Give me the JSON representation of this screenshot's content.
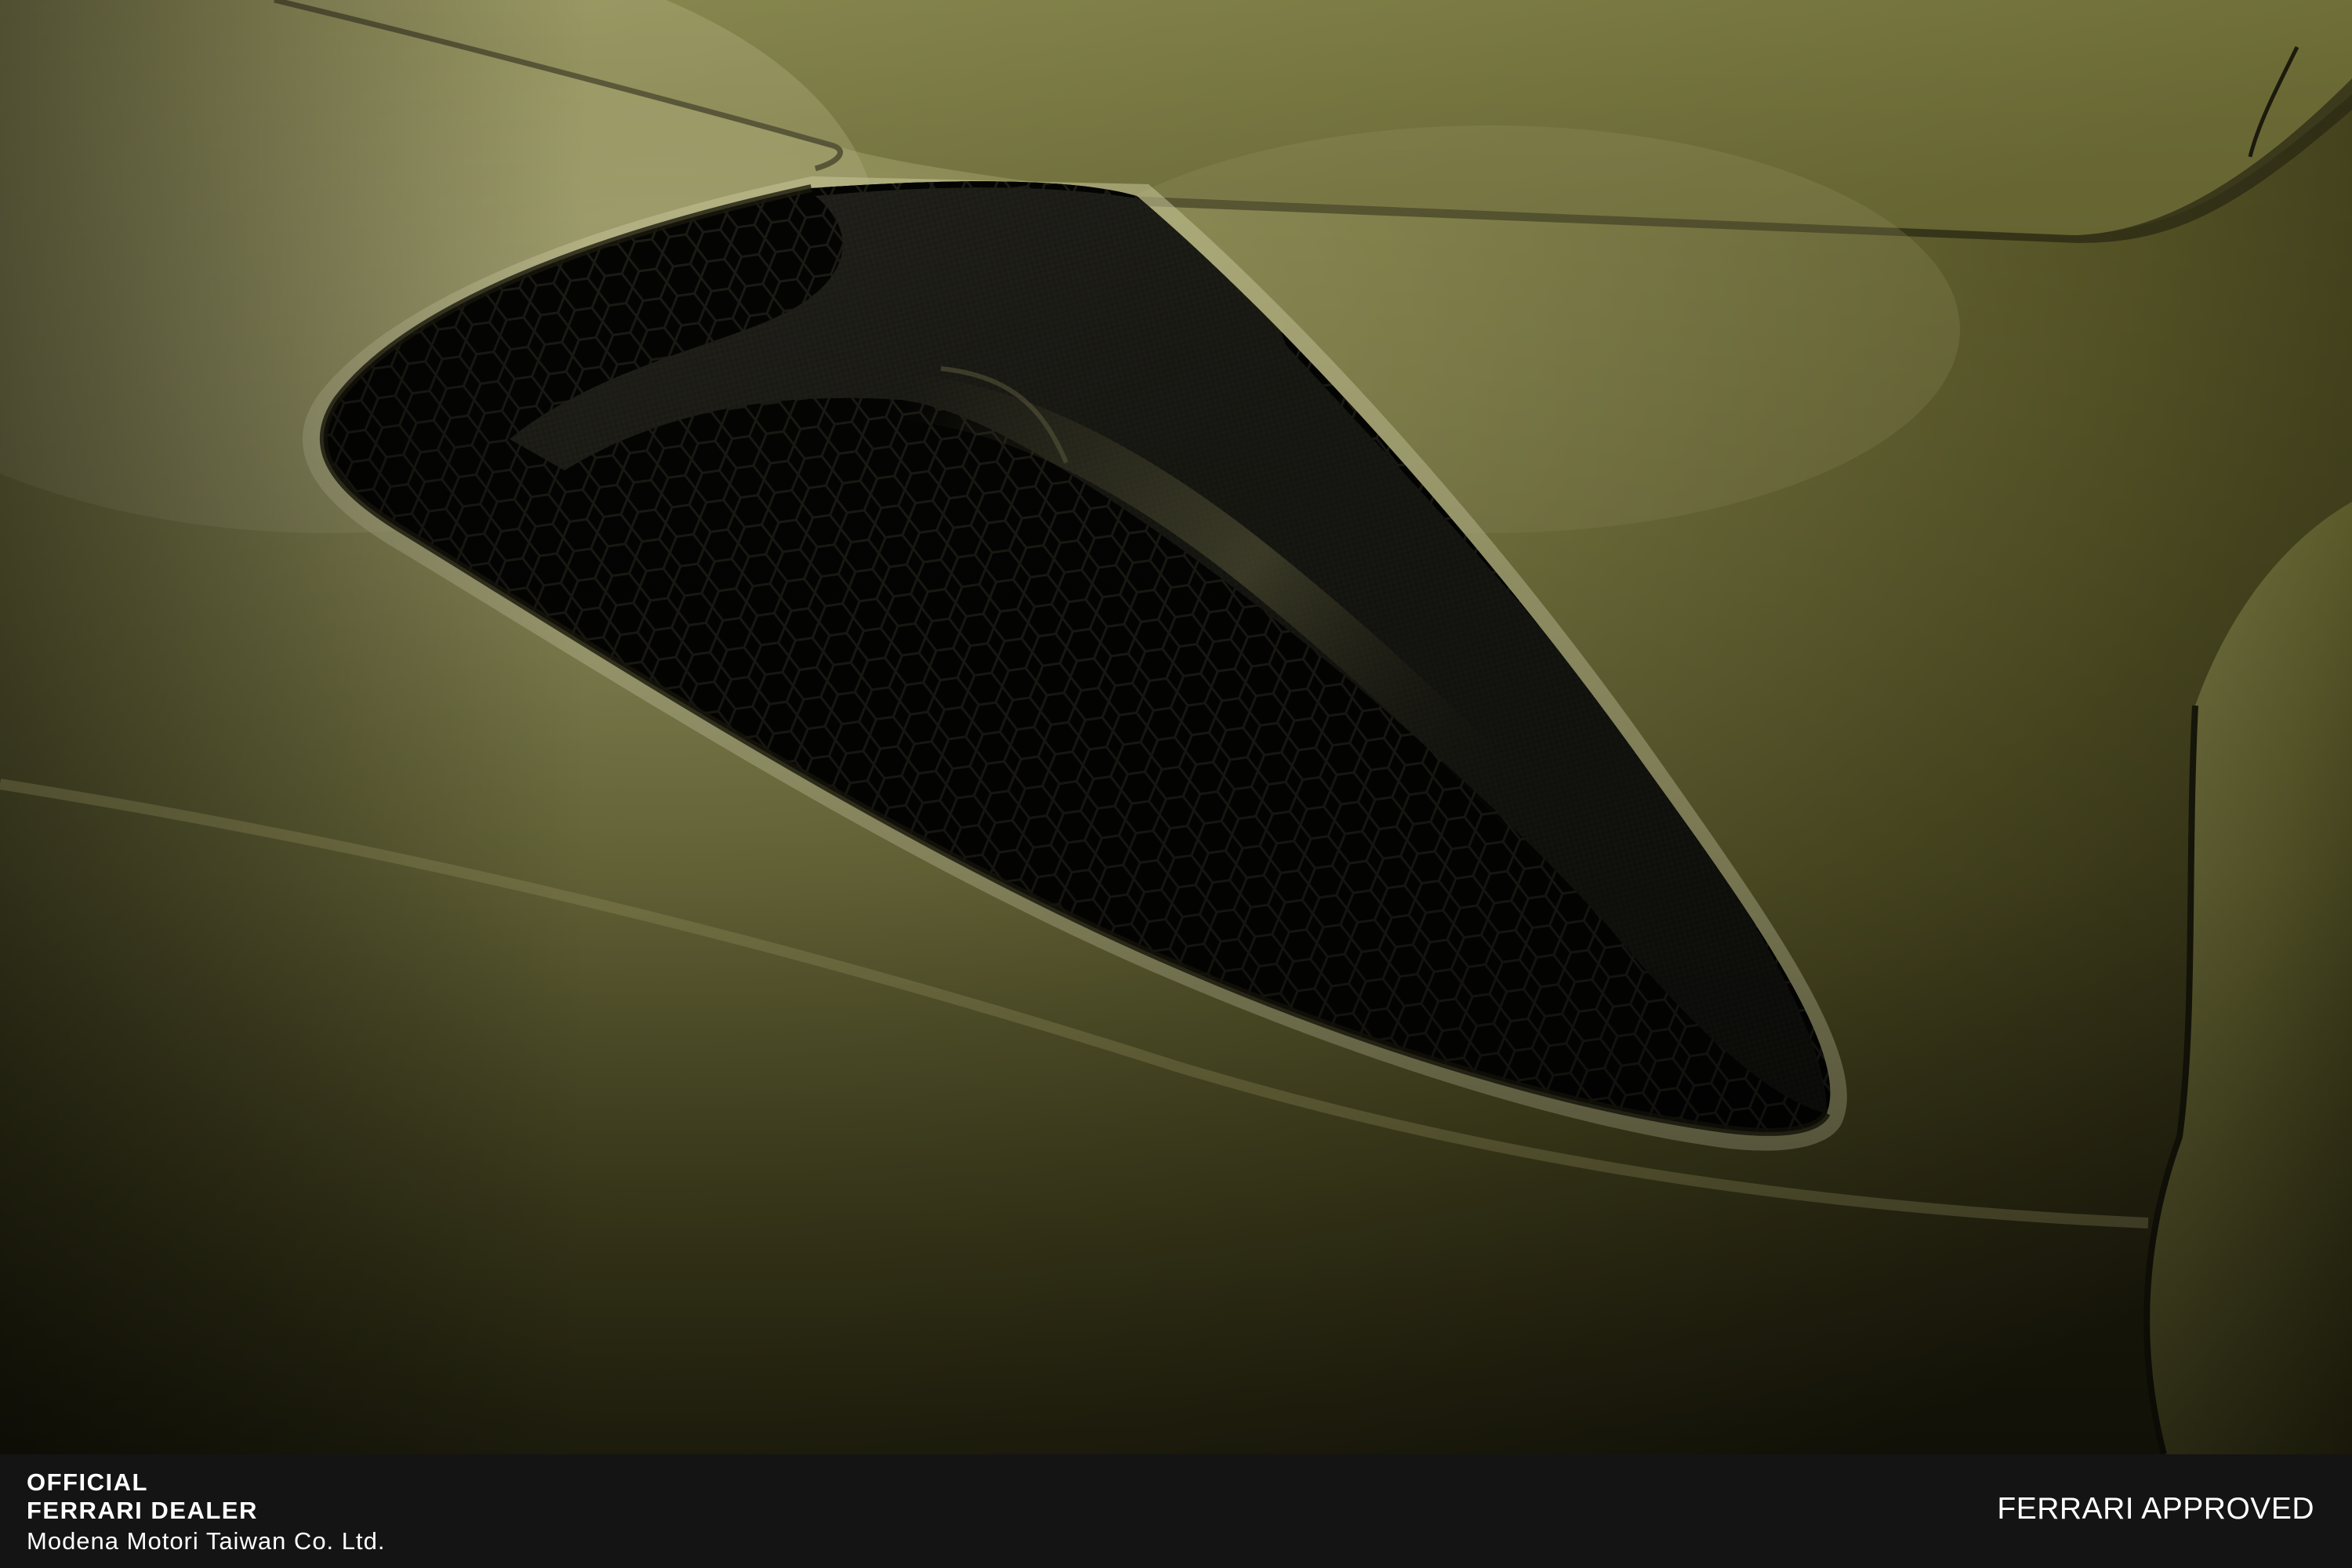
{
  "photo": {
    "subject": "side air intake with carbon-fibre blade and hexagonal mesh on olive green car body",
    "colors": {
      "paint_highlight": "#a8a772",
      "paint_mid": "#6f6f3a",
      "paint_shadow": "#2a2812",
      "carbon": "#151510",
      "mesh_dark": "#050504"
    }
  },
  "footer": {
    "badge_line1": "OFFICIAL",
    "badge_line2": "FERRARI DEALER",
    "company": "Modena Motori Taiwan Co. Ltd.",
    "approved": "FERRARI APPROVED",
    "background": "#141414",
    "text_color": "#ffffff"
  }
}
